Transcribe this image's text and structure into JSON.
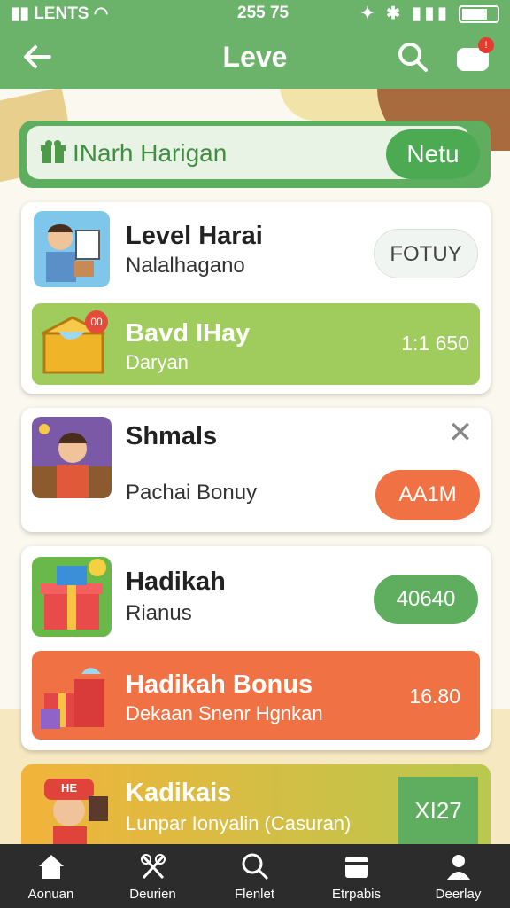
{
  "status_bar": {
    "carrier": "LENTS",
    "time": "255 75",
    "indicators": "✦ ✱ ▮▮▮"
  },
  "header": {
    "title": "Leve",
    "notification_count": "!"
  },
  "banner": {
    "text": "INarh Harigan",
    "button_label": "Netu"
  },
  "card1": {
    "title": "Level Harai",
    "subtitle": "Nalalhagano",
    "pill_label": "FOTUY",
    "strip": {
      "title": "Bavd IHay",
      "subtitle": "Daryan",
      "value": "1:1 650",
      "badge": "00"
    }
  },
  "card2": {
    "title": "Shmals",
    "subtitle": "Pachai Bonuy",
    "button_label": "AA1M",
    "close_label": "✕"
  },
  "card3": {
    "title": "Hadikah",
    "subtitle": "Rianus",
    "pill_label": "40640",
    "strip": {
      "title": "Hadikah Bonus",
      "subtitle": "Dekaan Snenr Hgnkan",
      "value": "16.80"
    }
  },
  "card4": {
    "title": "Kadikais",
    "subtitle": "Lunpar Ionyalin (Casuran)",
    "value": "XI27",
    "sign_text": "HE"
  },
  "nav": [
    {
      "label": "Aonuan",
      "icon": "home-icon"
    },
    {
      "label": "Deurien",
      "icon": "tools-icon"
    },
    {
      "label": "Flenlet",
      "icon": "search-icon"
    },
    {
      "label": "Etrpabis",
      "icon": "wallet-icon"
    },
    {
      "label": "Deerlay",
      "icon": "profile-icon"
    }
  ],
  "colors": {
    "primary_green": "#6bb36a",
    "lime": "#9fcc5c",
    "orange": "#f07144",
    "nav_bg": "#2c2c2c"
  }
}
